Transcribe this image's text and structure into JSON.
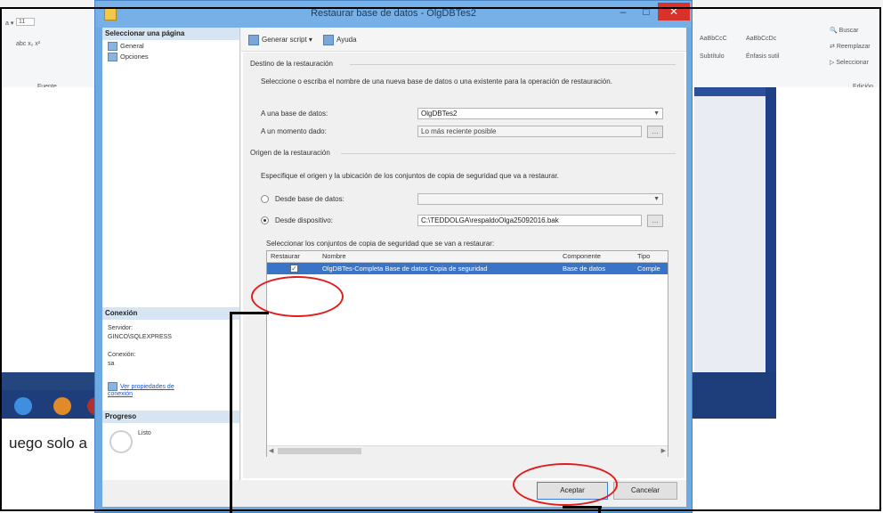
{
  "background": {
    "ribbon": {
      "font_size": "11",
      "font_group_label": "Fuente",
      "styles": [
        "AaBbCcC",
        "AaBbCcDc"
      ],
      "style_names": [
        "Subtítulo",
        "Énfasis sutil"
      ],
      "find": "Buscar",
      "replace": "Reemplazar",
      "select": "Seleccionar",
      "edit_group": "Edición"
    },
    "bottom_text": "uego solo a"
  },
  "dialog": {
    "title": "Restaurar base de datos - OlgDBTes2",
    "left": {
      "select_page_header": "Seleccionar una página",
      "pages": [
        "General",
        "Opciones"
      ],
      "connection_header": "Conexión",
      "server_label": "Servidor:",
      "server_value": "GINCO\\SQLEXPRESS",
      "connection_label": "Conexión:",
      "connection_value": "sa",
      "view_props_link": "Ver propiedades de conexión",
      "progress_header": "Progreso",
      "progress_status": "Listo"
    },
    "toolbar": {
      "script": "Generar script",
      "help": "Ayuda"
    },
    "dest": {
      "section": "Destino de la restauración",
      "instructions": "Seleccione o escriba el nombre de una nueva base de datos o una existente para la operación de restauración.",
      "db_label": "A una base de datos:",
      "db_value": "OlgDBTes2",
      "time_label": "A un momento dado:",
      "time_value": "Lo más reciente posible"
    },
    "source": {
      "section": "Origen de la restauración",
      "instructions": "Especifique el origen y la ubicación de los conjuntos de copia de seguridad que va a restaurar.",
      "from_db_label": "Desde base de datos:",
      "from_device_label": "Desde dispositivo:",
      "device_value": "C:\\TEDDOLGA\\respaldoOlga25092016.bak",
      "selected_option": "device"
    },
    "backup_sets": {
      "caption": "Seleccionar los conjuntos de copia de seguridad que se van a restaurar:",
      "columns": [
        "Restaurar",
        "Nombre",
        "Componente",
        "Tipo"
      ],
      "rows": [
        {
          "restore": true,
          "name": "OlgDBTes-Completa Base de datos Copia de seguridad",
          "component": "Base de datos",
          "type": "Comple"
        }
      ]
    },
    "buttons": {
      "ok": "Aceptar",
      "cancel": "Cancelar"
    }
  },
  "colors": {
    "title_bar": "#77b0e6",
    "close_button": "#d9322b",
    "selection": "#3a74c6",
    "annotation": "#e01d1d"
  }
}
